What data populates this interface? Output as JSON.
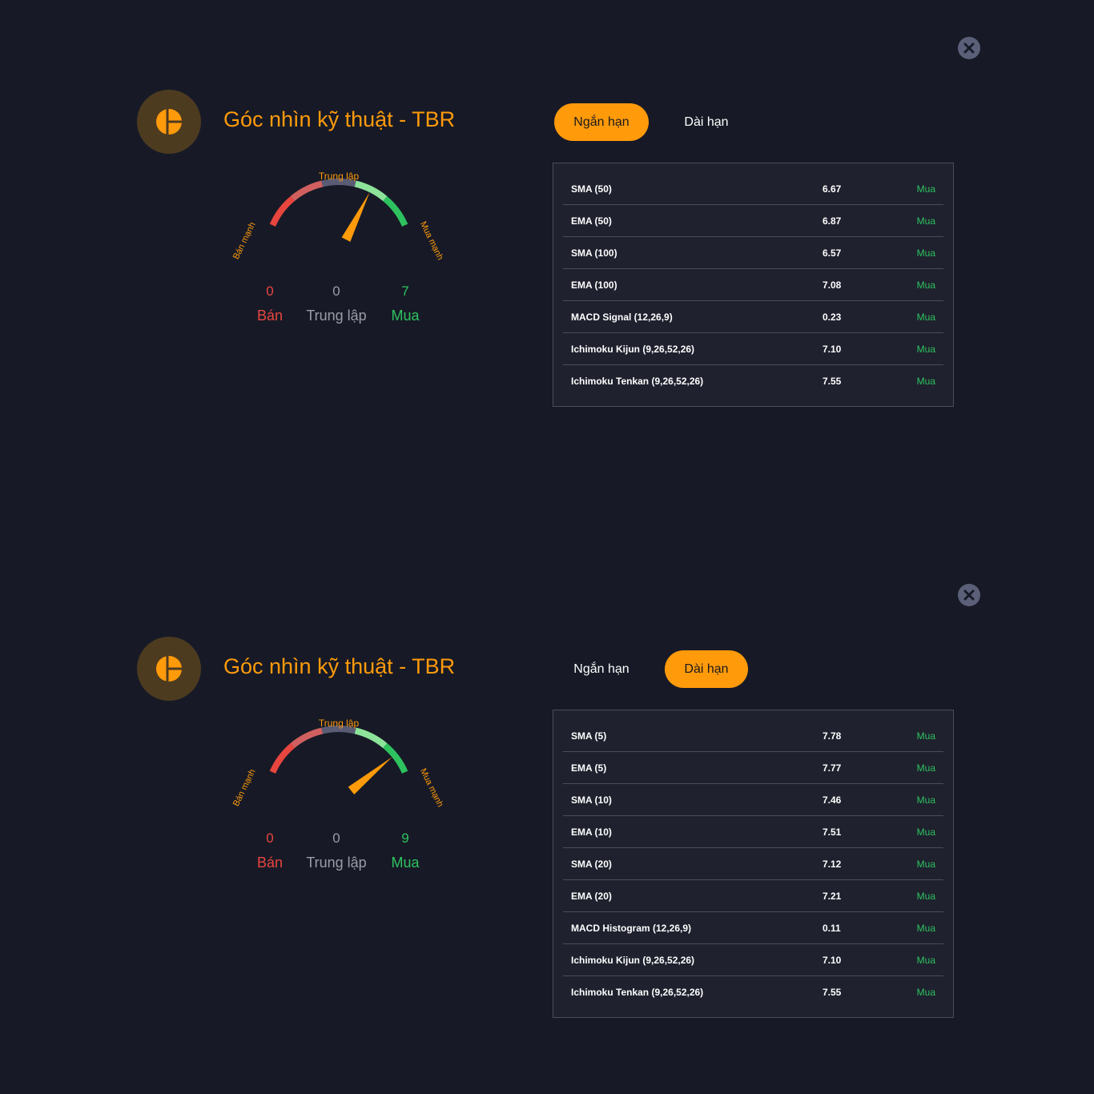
{
  "colors": {
    "background": "#171a26",
    "accent": "#ff9a0b",
    "sell": "#e8453f",
    "neutral": "#9a9ca6",
    "buy": "#2ec25f"
  },
  "panels": [
    {
      "title": "Góc nhìn kỹ thuật - TBR",
      "tabs": [
        {
          "label": "Ngắn hạn",
          "active": true
        },
        {
          "label": "Dài hạn",
          "active": false
        }
      ],
      "gauge": {
        "label_neutral": "Trung lập",
        "label_strong_sell": "Bán mạnh",
        "label_strong_buy": "Mua mạnh",
        "level": 0.7
      },
      "counts": {
        "sell": "0",
        "neutral": "0",
        "buy": "7",
        "sell_label": "Bán",
        "neutral_label": "Trung lập",
        "buy_label": "Mua"
      },
      "indicators": [
        {
          "name": "SMA (50)",
          "value": "6.67",
          "signal": "Mua"
        },
        {
          "name": "EMA (50)",
          "value": "6.87",
          "signal": "Mua"
        },
        {
          "name": "SMA (100)",
          "value": "6.57",
          "signal": "Mua"
        },
        {
          "name": "EMA (100)",
          "value": "7.08",
          "signal": "Mua"
        },
        {
          "name": "MACD Signal (12,26,9)",
          "value": "0.23",
          "signal": "Mua"
        },
        {
          "name": "Ichimoku Kijun (9,26,52,26)",
          "value": "7.10",
          "signal": "Mua"
        },
        {
          "name": "Ichimoku Tenkan (9,26,52,26)",
          "value": "7.55",
          "signal": "Mua"
        }
      ]
    },
    {
      "title": "Góc nhìn kỹ thuật - TBR",
      "tabs": [
        {
          "label": "Ngắn hạn",
          "active": false
        },
        {
          "label": "Dài hạn",
          "active": true
        }
      ],
      "gauge": {
        "label_neutral": "Trung lập",
        "label_strong_sell": "Bán mạnh",
        "label_strong_buy": "Mua mạnh",
        "level": 0.88
      },
      "counts": {
        "sell": "0",
        "neutral": "0",
        "buy": "9",
        "sell_label": "Bán",
        "neutral_label": "Trung lập",
        "buy_label": "Mua"
      },
      "indicators": [
        {
          "name": "SMA (5)",
          "value": "7.78",
          "signal": "Mua"
        },
        {
          "name": "EMA (5)",
          "value": "7.77",
          "signal": "Mua"
        },
        {
          "name": "SMA (10)",
          "value": "7.46",
          "signal": "Mua"
        },
        {
          "name": "EMA (10)",
          "value": "7.51",
          "signal": "Mua"
        },
        {
          "name": "SMA (20)",
          "value": "7.12",
          "signal": "Mua"
        },
        {
          "name": "EMA (20)",
          "value": "7.21",
          "signal": "Mua"
        },
        {
          "name": "MACD Histogram (12,26,9)",
          "value": "0.11",
          "signal": "Mua"
        },
        {
          "name": "Ichimoku Kijun (9,26,52,26)",
          "value": "7.10",
          "signal": "Mua"
        },
        {
          "name": "Ichimoku Tenkan (9,26,52,26)",
          "value": "7.55",
          "signal": "Mua"
        }
      ]
    }
  ]
}
